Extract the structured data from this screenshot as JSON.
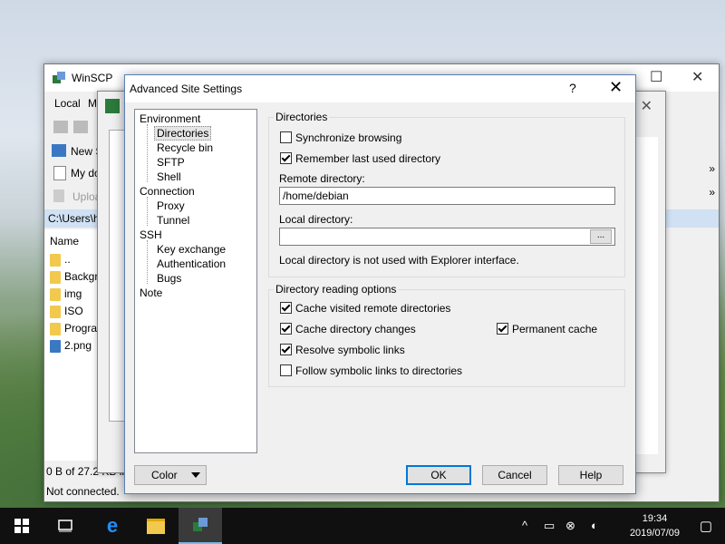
{
  "main_window": {
    "title": "WinSCP",
    "menu": [
      "Local",
      "M"
    ],
    "new_session": "New S",
    "my_documents": "My do",
    "upload": "Uploa",
    "path": "C:\\Users\\h",
    "file_header": "Name",
    "files": [
      "..",
      "Backgr",
      "img",
      "ISO",
      "Progra",
      "2.png"
    ],
    "status_size": "0 B of 27.2 KB in",
    "status_conn": "Not connected."
  },
  "dialog": {
    "title": "Advanced Site Settings",
    "help_glyph": "?",
    "close_glyph": "✕",
    "tree": {
      "environment": "Environment",
      "directories": "Directories",
      "recycle_bin": "Recycle bin",
      "sftp": "SFTP",
      "shell": "Shell",
      "connection": "Connection",
      "proxy": "Proxy",
      "tunnel": "Tunnel",
      "ssh": "SSH",
      "key_exchange": "Key exchange",
      "authentication": "Authentication",
      "bugs": "Bugs",
      "note": "Note"
    },
    "directories_group": {
      "title": "Directories",
      "sync_browsing": "Synchronize browsing",
      "sync_browsing_checked": false,
      "remember_last": "Remember last used directory",
      "remember_last_checked": true,
      "remote_label": "Remote directory:",
      "remote_value": "/home/debian",
      "local_label": "Local directory:",
      "local_value": "",
      "browse": "...",
      "local_note": "Local directory is not used with Explorer interface."
    },
    "reading_group": {
      "title": "Directory reading options",
      "cache_visited": "Cache visited remote directories",
      "cache_visited_checked": true,
      "cache_changes": "Cache directory changes",
      "cache_changes_checked": true,
      "permanent_cache": "Permanent cache",
      "permanent_cache_checked": true,
      "resolve_links": "Resolve symbolic links",
      "resolve_links_checked": true,
      "follow_links": "Follow symbolic links to directories",
      "follow_links_checked": false
    },
    "buttons": {
      "color": "Color",
      "ok": "OK",
      "cancel": "Cancel",
      "help": "Help"
    }
  },
  "taskbar": {
    "time": "19:34",
    "date": "2019/07/09"
  }
}
